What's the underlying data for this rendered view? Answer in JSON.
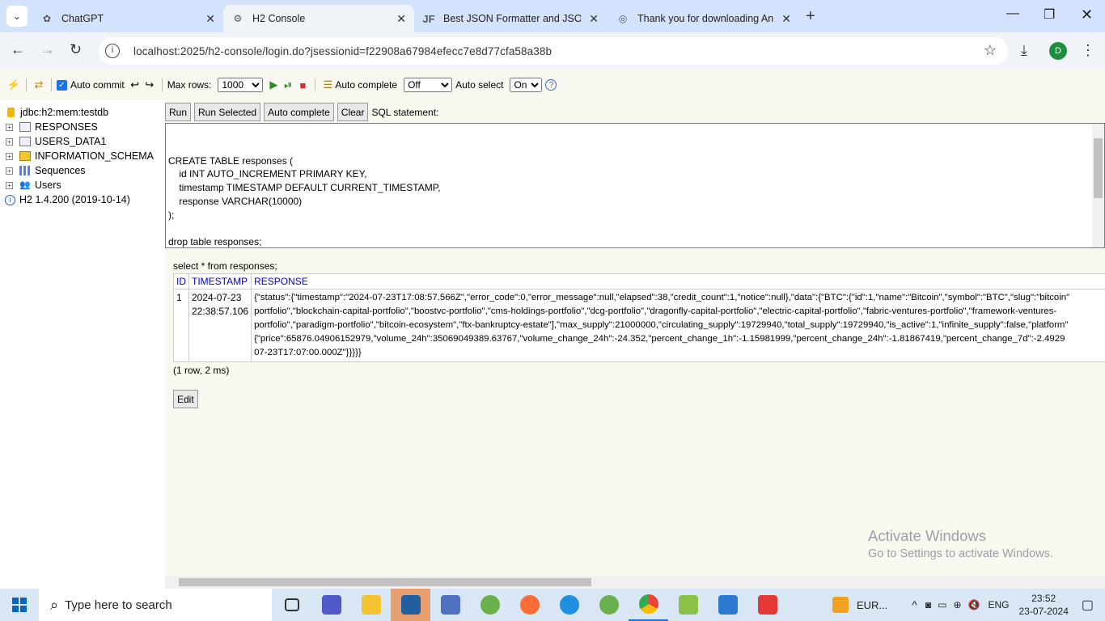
{
  "browser": {
    "tabs": [
      {
        "title": "ChatGPT",
        "icon": "chatgpt-icon"
      },
      {
        "title": "H2 Console",
        "icon": "h2-icon"
      },
      {
        "title": "Best JSON Formatter and JSON",
        "icon": "jf-icon"
      },
      {
        "title": "Thank you for downloading An",
        "icon": "globe-icon"
      }
    ],
    "url": "localhost:2025/h2-console/login.do?jsessionid=f22908a67984efecc7e8d77cfa58a38b",
    "profile_initial": "D"
  },
  "h2toolbar": {
    "auto_commit": "Auto commit",
    "max_rows_label": "Max rows:",
    "max_rows": "1000",
    "auto_complete_label": "Auto complete",
    "auto_complete": "Off",
    "auto_select_label": "Auto select",
    "auto_select": "On"
  },
  "tree": {
    "connection": "jdbc:h2:mem:testdb",
    "items": [
      "RESPONSES",
      "USERS_DATA1",
      "INFORMATION_SCHEMA",
      "Sequences",
      "Users"
    ],
    "version": "H2 1.4.200 (2019-10-14)"
  },
  "query": {
    "buttons": {
      "run": "Run",
      "run_selected": "Run Selected",
      "auto_complete": "Auto complete",
      "clear": "Clear"
    },
    "sql_label": "SQL statement:",
    "sql_text": "\nCREATE TABLE responses (\n    id INT AUTO_INCREMENT PRIMARY KEY,\n    timestamp TIMESTAMP DEFAULT CURRENT_TIMESTAMP,\n    response VARCHAR(10000)\n);\n\ndrop table responses;"
  },
  "result": {
    "statement": "select * from responses;",
    "columns": [
      "ID",
      "TIMESTAMP",
      "RESPONSE"
    ],
    "row": {
      "id": "1",
      "ts1": "2024-07-23",
      "ts2": "22:38:57.106",
      "resp_lines": [
        "{\"status\":{\"timestamp\":\"2024-07-23T17:08:57.566Z\",\"error_code\":0,\"error_message\":null,\"elapsed\":38,\"credit_count\":1,\"notice\":null},\"data\":{\"BTC\":{\"id\":1,\"name\":\"Bitcoin\",\"symbol\":\"BTC\",\"slug\":\"bitcoin\"",
        "portfolio\",\"blockchain-capital-portfolio\",\"boostvc-portfolio\",\"cms-holdings-portfolio\",\"dcg-portfolio\",\"dragonfly-capital-portfolio\",\"electric-capital-portfolio\",\"fabric-ventures-portfolio\",\"framework-ventures-",
        "portfolio\",\"paradigm-portfolio\",\"bitcoin-ecosystem\",\"ftx-bankruptcy-estate\"],\"max_supply\":21000000,\"circulating_supply\":19729940,\"total_supply\":19729940,\"is_active\":1,\"infinite_supply\":false,\"platform\"",
        "{\"price\":65876.04906152979,\"volume_24h\":35069049389.63767,\"volume_change_24h\":-24.352,\"percent_change_1h\":-1.15981999,\"percent_change_24h\":-1.81867419,\"percent_change_7d\":-2.4929",
        "07-23T17:07:00.000Z\"}}}}}"
      ]
    },
    "summary": "(1 row, 2 ms)",
    "edit": "Edit"
  },
  "watermark": {
    "line1": "Activate Windows",
    "line2": "Go to Settings to activate Windows."
  },
  "taskbar": {
    "search_placeholder": "Type here to search",
    "tray_currency": "EUR...",
    "lang": "ENG",
    "time": "23:52",
    "date": "23-07-2024"
  }
}
